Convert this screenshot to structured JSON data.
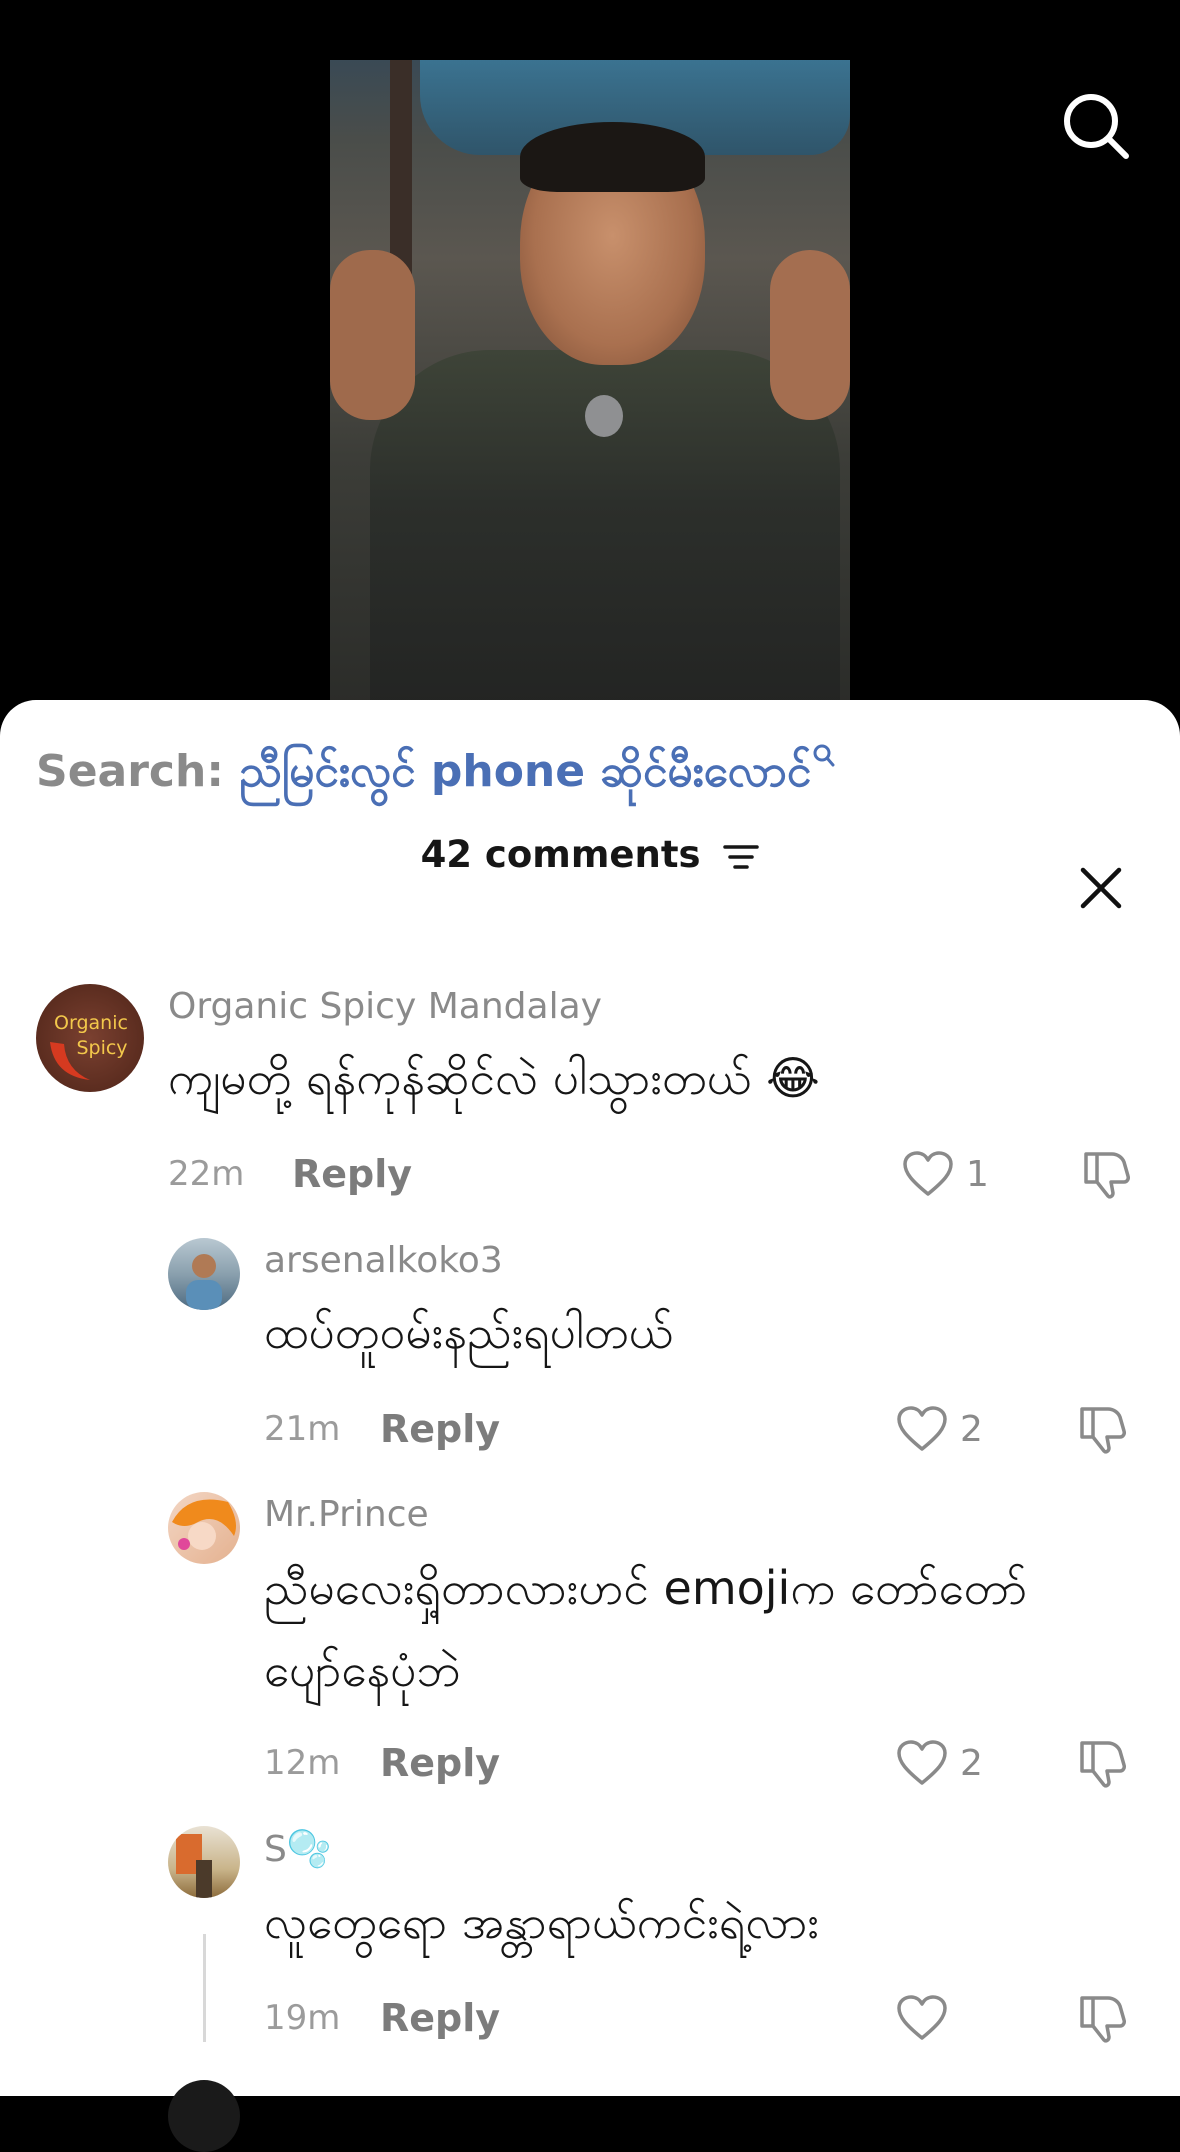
{
  "search": {
    "prefix": "Search: ",
    "query": "ညီမြင်းလွင် phone ဆိုင်မီးလောင်"
  },
  "comments_header": {
    "title": "42 comments"
  },
  "comments": [
    {
      "username": "Organic Spicy Mandalay",
      "avatar_text_1": "Organic",
      "avatar_text_2": "Spicy",
      "text": "ကျမတို့ ရန်ကုန်ဆိုင်လဲ ပါသွားတယ် 😂",
      "time": "22m",
      "reply_label": "Reply",
      "likes": "1"
    },
    {
      "username": "arsenalkoko3",
      "text": "ထပ်တူဝမ်းနည်းရပါတယ်",
      "time": "21m",
      "reply_label": "Reply",
      "likes": "2"
    },
    {
      "username": "Mr.Prince",
      "text_line1": "ညီမလေးရှိ့တာလားဟင် emojiက တော်တော်",
      "text_line2": "ပျော်နေပုံဘဲ",
      "time": "12m",
      "reply_label": "Reply",
      "likes": "2"
    },
    {
      "username": "S🫧",
      "text": "လူတွေရော အန္တာရာယ်ကင်းရဲ့လား",
      "time": "19m",
      "reply_label": "Reply",
      "likes": ""
    }
  ],
  "colors": {
    "query_blue": "#4a6fb5",
    "muted_gray": "#8a8a8a",
    "text_dark": "#161616",
    "avatar_brown": "#6b3a2a"
  }
}
